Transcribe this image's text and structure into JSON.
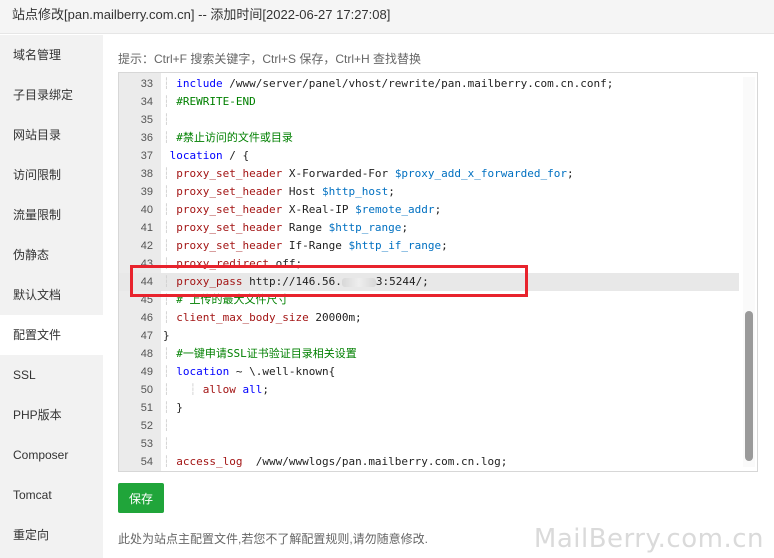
{
  "window": {
    "title": "站点修改[pan.mailberry.com.cn] -- 添加时间[2022-06-27 17:27:08]"
  },
  "sidebar": {
    "items": [
      {
        "label": "域名管理"
      },
      {
        "label": "子目录绑定"
      },
      {
        "label": "网站目录"
      },
      {
        "label": "访问限制"
      },
      {
        "label": "流量限制"
      },
      {
        "label": "伪静态"
      },
      {
        "label": "默认文档"
      },
      {
        "label": "配置文件",
        "active": true
      },
      {
        "label": "SSL"
      },
      {
        "label": "PHP版本"
      },
      {
        "label": "Composer"
      },
      {
        "label": "Tomcat"
      },
      {
        "label": "重定向"
      }
    ]
  },
  "hint": "提示：Ctrl+F 搜索关键字，Ctrl+S 保存，Ctrl+H 查找替换",
  "editor": {
    "lines": [
      {
        "n": "33",
        "parts": [
          {
            "t": "include",
            "c": "kw"
          },
          {
            "t": " /www/server/panel/vhost/rewrite/pan.mailberry.com.cn.conf;",
            "c": ""
          }
        ]
      },
      {
        "n": "34",
        "parts": [
          {
            "t": "#REWRITE-END",
            "c": "cm"
          }
        ]
      },
      {
        "n": "35",
        "parts": []
      },
      {
        "n": "36",
        "parts": [
          {
            "t": "#禁止访问的文件或目录",
            "c": "cm"
          }
        ]
      },
      {
        "n": "37",
        "parts": [
          {
            "t": "location",
            "c": "kw"
          },
          {
            "t": " / {",
            "c": ""
          }
        ]
      },
      {
        "n": "38",
        "parts": [
          {
            "t": "proxy_set_header",
            "c": "dir"
          },
          {
            "t": " X-Forwarded-For ",
            "c": ""
          },
          {
            "t": "$proxy_add_x_forwarded_for",
            "c": "var"
          },
          {
            "t": ";",
            "c": ""
          }
        ]
      },
      {
        "n": "39",
        "parts": [
          {
            "t": "proxy_set_header",
            "c": "dir"
          },
          {
            "t": " Host ",
            "c": ""
          },
          {
            "t": "$http_host",
            "c": "var"
          },
          {
            "t": ";",
            "c": ""
          }
        ]
      },
      {
        "n": "40",
        "parts": [
          {
            "t": "proxy_set_header",
            "c": "dir"
          },
          {
            "t": " X-Real-IP ",
            "c": ""
          },
          {
            "t": "$remote_addr",
            "c": "var"
          },
          {
            "t": ";",
            "c": ""
          }
        ]
      },
      {
        "n": "41",
        "parts": [
          {
            "t": "proxy_set_header",
            "c": "dir"
          },
          {
            "t": " Range ",
            "c": ""
          },
          {
            "t": "$http_range",
            "c": "var"
          },
          {
            "t": ";",
            "c": ""
          }
        ]
      },
      {
        "n": "42",
        "parts": [
          {
            "t": "proxy_set_header",
            "c": "dir"
          },
          {
            "t": " If-Range ",
            "c": ""
          },
          {
            "t": "$http_if_range",
            "c": "var"
          },
          {
            "t": ";",
            "c": ""
          }
        ]
      },
      {
        "n": "43",
        "parts": [
          {
            "t": "proxy_redirect",
            "c": "dir"
          },
          {
            "t": " off;",
            "c": ""
          }
        ]
      },
      {
        "n": "44",
        "active": true,
        "parts": [
          {
            "t": "proxy_pass",
            "c": "dir"
          },
          {
            "t": " http://146.56.",
            "c": ""
          },
          {
            "t": "",
            "c": "blur"
          },
          {
            "t": "3:5244/;",
            "c": ""
          }
        ]
      },
      {
        "n": "45",
        "parts": [
          {
            "t": "# 上传的最大文件尺寸",
            "c": "cm"
          }
        ]
      },
      {
        "n": "46",
        "parts": [
          {
            "t": "client_max_body_size",
            "c": "dir"
          },
          {
            "t": " 20000m;",
            "c": ""
          }
        ]
      },
      {
        "n": "47",
        "parts": [
          {
            "t": "}",
            "c": ""
          }
        ]
      },
      {
        "n": "48",
        "parts": [
          {
            "t": "#一键申请SSL证书验证目录相关设置",
            "c": "cm"
          }
        ]
      },
      {
        "n": "49",
        "parts": [
          {
            "t": "location",
            "c": "kw"
          },
          {
            "t": " ~ \\.well-known{",
            "c": ""
          }
        ]
      },
      {
        "n": "50",
        "parts": [
          {
            "t": "allow",
            "c": "dir"
          },
          {
            "t": " ",
            "c": ""
          },
          {
            "t": "all",
            "c": "kw"
          },
          {
            "t": ";",
            "c": ""
          }
        ]
      },
      {
        "n": "51",
        "parts": [
          {
            "t": "}",
            "c": ""
          }
        ]
      },
      {
        "n": "52",
        "parts": []
      },
      {
        "n": "53",
        "parts": []
      },
      {
        "n": "54",
        "parts": [
          {
            "t": "access_log",
            "c": "dir"
          },
          {
            "t": "  /www/wwwlogs/pan.mailberry.com.cn.log;",
            "c": ""
          }
        ]
      }
    ]
  },
  "save_label": "保存",
  "note": "此处为站点主配置文件,若您不了解配置规则,请勿随意修改.",
  "watermark": "MailBerry.com.cn"
}
